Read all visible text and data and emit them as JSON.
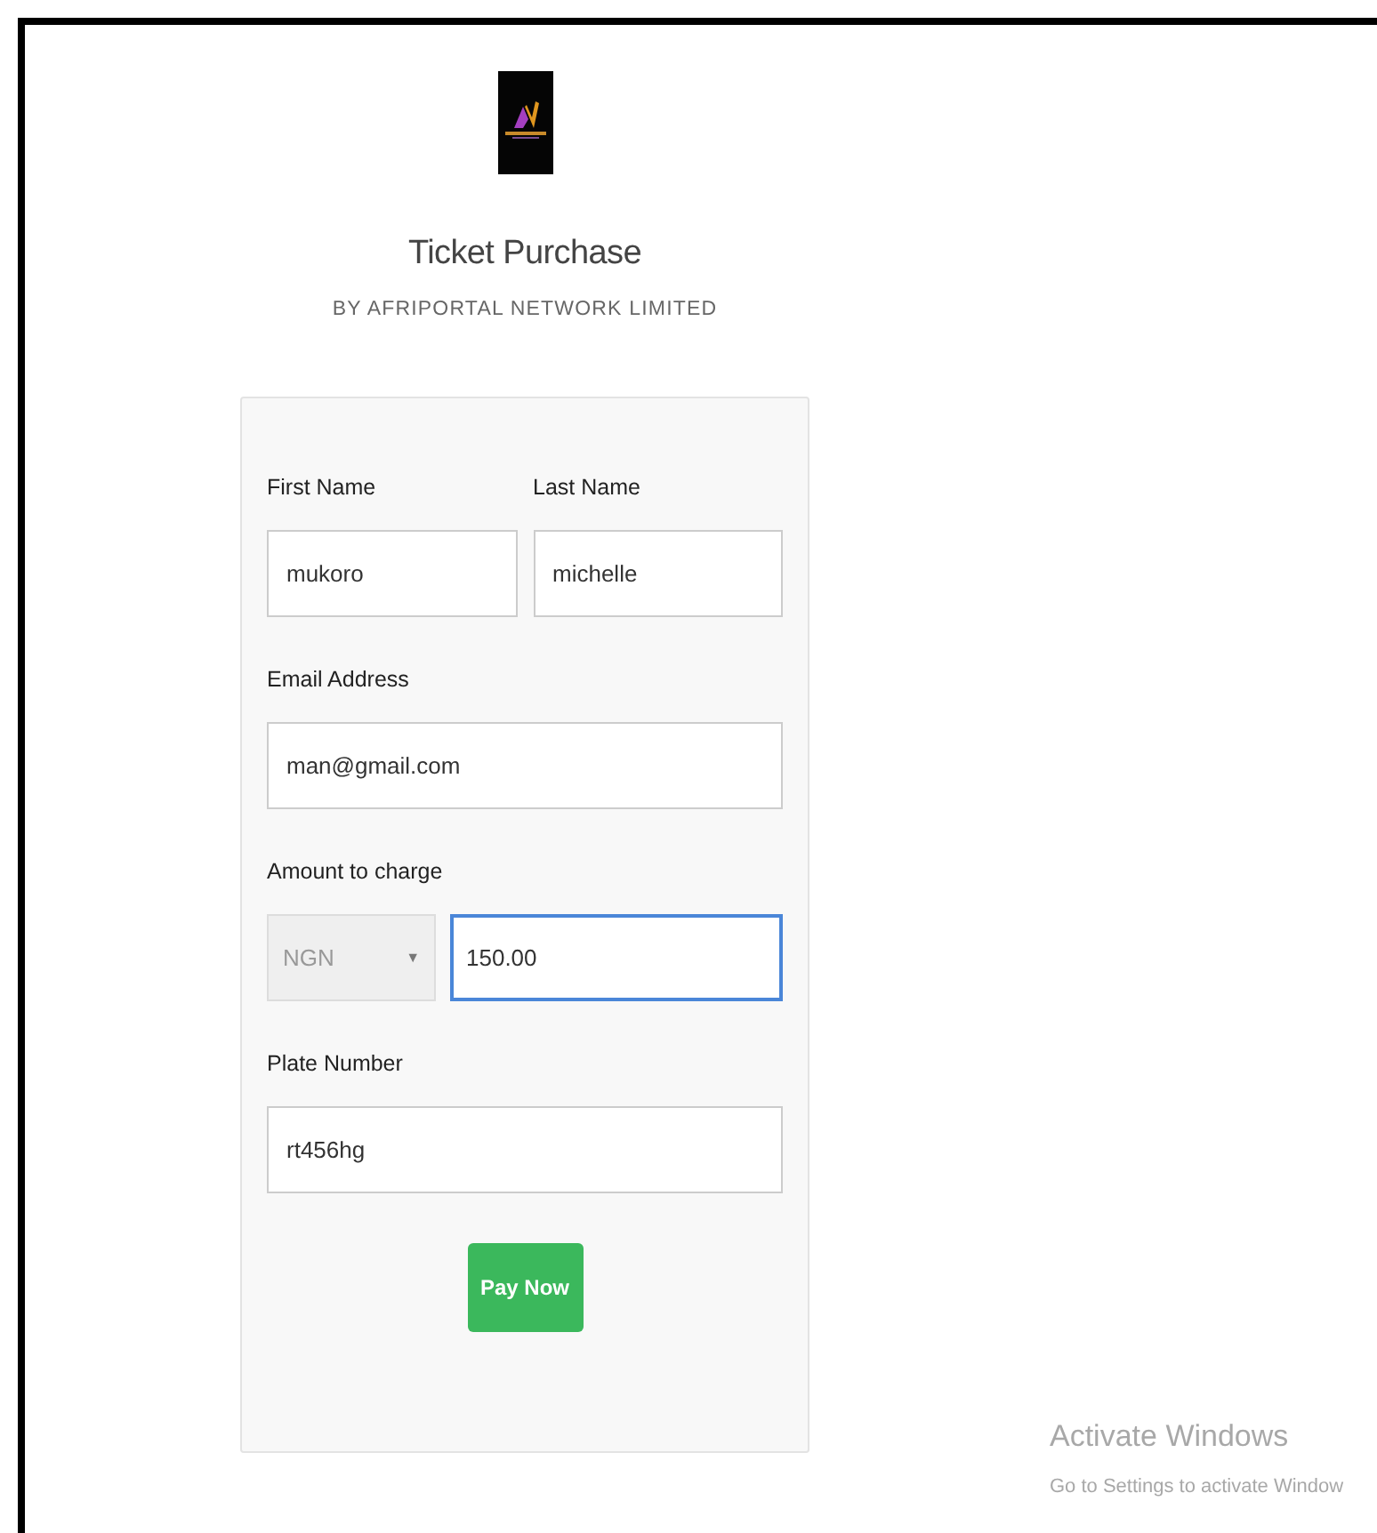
{
  "header": {
    "title": "Ticket Purchase",
    "subtitle": "BY AFRIPORTAL NETWORK LIMITED"
  },
  "form": {
    "rows": [
      {
        "fields": [
          {
            "label": "First Name",
            "kind": "text",
            "value": "mukoro",
            "focused": false
          }
        ],
        "pair": [
          {
            "label": "Last Name",
            "kind": "text",
            "value": "michelle",
            "focused": false
          }
        ]
      },
      {
        "fields": [
          {
            "label": "Email Address",
            "kind": "text",
            "value": "man@gmail.com",
            "focused": false
          }
        ]
      },
      {
        "fields": [
          {
            "label": "Amount to charge",
            "kind": "currency",
            "currency": "NGN",
            "currency_disabled": true,
            "caret": "▼",
            "value": "150.00",
            "focused": true
          }
        ]
      },
      {
        "fields": [
          {
            "label": "Plate Number",
            "kind": "text",
            "value": "rt456hg",
            "focused": false
          }
        ]
      }
    ],
    "submit": "Pay Now"
  },
  "os_notice": {
    "title": "Activate Windows",
    "text": "Go to Settings to activate Window"
  }
}
